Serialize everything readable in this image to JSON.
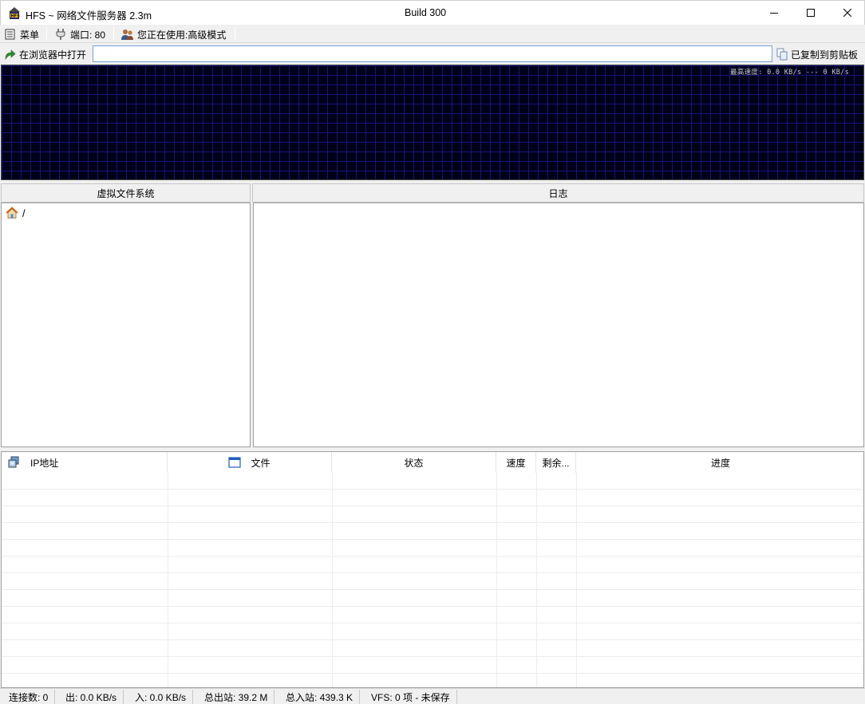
{
  "window": {
    "title": "HFS ~ 网络文件服务器 2.3m",
    "build": "Build 300",
    "controls": {
      "minimize_icon": "minimize-icon",
      "maximize_icon": "maximize-icon",
      "close_icon": "close-icon"
    }
  },
  "toolbar": {
    "menu_label": "菜单",
    "port_label": "端口: 80",
    "mode_label": "您正在使用:高级模式"
  },
  "urlbar": {
    "open_label": "在浏览器中打开",
    "url_value": "",
    "copy_label": "已复制到剪贴板"
  },
  "graph": {
    "label": "最高速度: 0.0 KB/s --- 0 KB/s",
    "background_color": "#000018",
    "grid_color": "#15157a"
  },
  "vfs": {
    "header": "虚拟文件系统",
    "root_label": "/"
  },
  "log": {
    "header": "日志"
  },
  "connections": {
    "columns": [
      "IP地址",
      "文件",
      "状态",
      "速度",
      "剩余...",
      "进度"
    ],
    "rows": []
  },
  "statusbar": {
    "connections": "连接数: 0",
    "out_speed": "出: 0.0 KB/s",
    "in_speed": "入: 0.0 KB/s",
    "total_out": "总出站: 39.2 M",
    "total_in": "总入站: 439.3 K",
    "vfs_status": "VFS: 0 项 - 未保存"
  }
}
